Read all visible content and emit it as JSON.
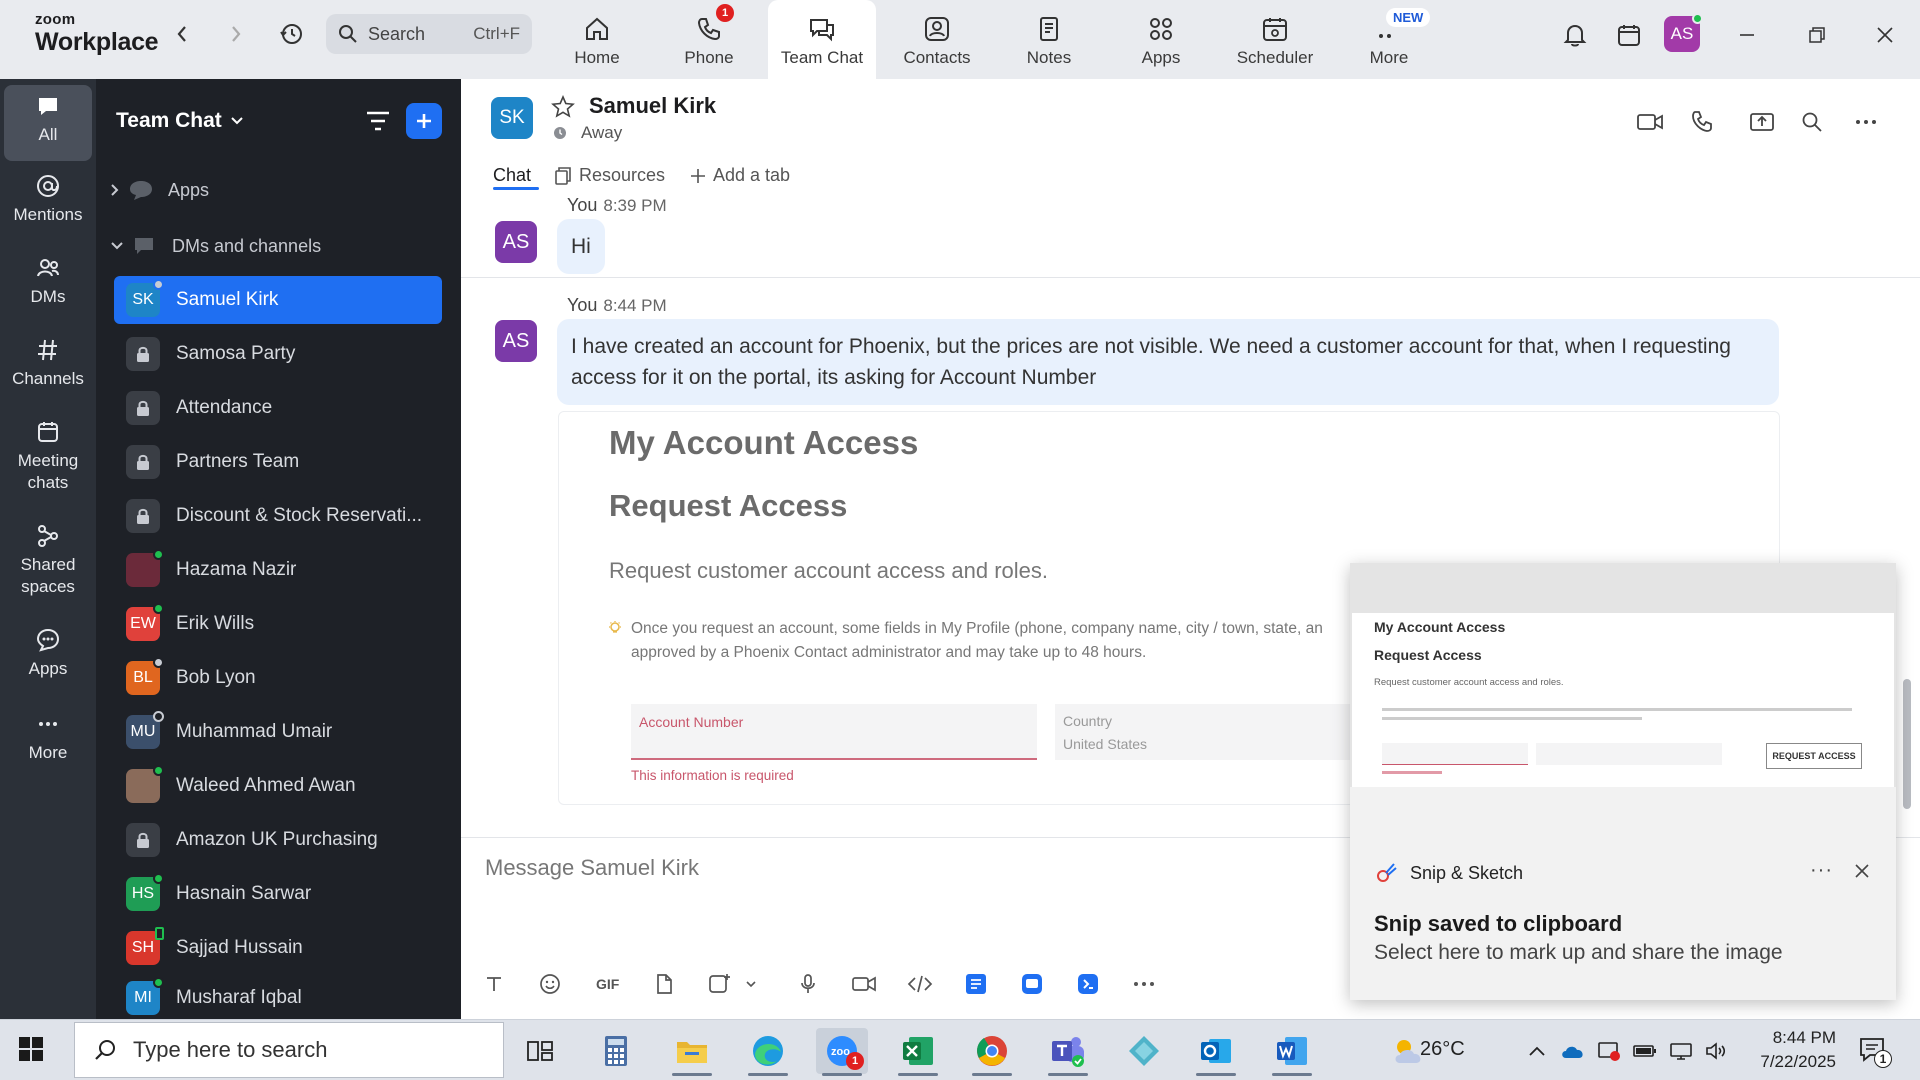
{
  "brand": {
    "line1": "zoom",
    "line2": "Workplace"
  },
  "search": {
    "placeholder": "Search",
    "shortcut": "Ctrl+F"
  },
  "nav": {
    "tabs": [
      {
        "label": "Home",
        "icon": "home-icon"
      },
      {
        "label": "Phone",
        "icon": "phone-icon",
        "badge": "1"
      },
      {
        "label": "Team Chat",
        "icon": "chat-icon",
        "active": true
      },
      {
        "label": "Contacts",
        "icon": "contacts-icon"
      },
      {
        "label": "Notes",
        "icon": "notes-icon"
      },
      {
        "label": "Apps",
        "icon": "apps-icon"
      },
      {
        "label": "Scheduler",
        "icon": "scheduler-icon"
      },
      {
        "label": "More",
        "icon": "more-icon",
        "new_badge": "NEW"
      }
    ],
    "user_initials": "AS"
  },
  "rail": {
    "items": [
      {
        "label": "All",
        "active": true
      },
      {
        "label": "Mentions"
      },
      {
        "label": "DMs"
      },
      {
        "label": "Channels"
      },
      {
        "label": "Meeting chats"
      },
      {
        "label": "Shared spaces"
      },
      {
        "label": "Apps"
      },
      {
        "label": "More"
      }
    ]
  },
  "sidebar": {
    "title": "Team Chat",
    "groups": {
      "apps": "Apps",
      "dms": "DMs and channels"
    },
    "items": [
      {
        "name": "Samuel Kirk",
        "initials": "SK",
        "color": "#1e85c7",
        "status": "away",
        "selected": true
      },
      {
        "name": "Samosa Party",
        "locked": true
      },
      {
        "name": "Attendance",
        "locked": true
      },
      {
        "name": "Partners Team",
        "locked": true
      },
      {
        "name": "Discount & Stock Reservati...",
        "locked": true
      },
      {
        "name": "Hazama Nazir",
        "initials": "",
        "color": "#6b2a3a",
        "status": "online"
      },
      {
        "name": "Erik Wills",
        "initials": "EW",
        "color": "#e0413b",
        "status": "online"
      },
      {
        "name": "Bob Lyon",
        "initials": "BL",
        "color": "#e0661f",
        "status": "away"
      },
      {
        "name": "Muhammad Umair",
        "initials": "MU",
        "color": "#3b4f6b",
        "status": "offline"
      },
      {
        "name": "Waleed Ahmed Awan",
        "initials": "",
        "color": "#8a6b5a",
        "status": "online"
      },
      {
        "name": "Amazon UK Purchasing",
        "locked": true
      },
      {
        "name": "Hasnain Sarwar",
        "initials": "HS",
        "color": "#1f9d55",
        "status": "online"
      },
      {
        "name": "Sajjad Hussain",
        "initials": "SH",
        "color": "#d9372c",
        "status": "mobile"
      },
      {
        "name": "Musharaf Iqbal",
        "initials": "MI",
        "color": "#1e85c7",
        "status": "online"
      }
    ]
  },
  "chat": {
    "contact_initials": "SK",
    "contact_name": "Samuel Kirk",
    "contact_status": "Away",
    "tabs": {
      "chat": "Chat",
      "resources": "Resources",
      "add": "Add a tab"
    },
    "messages": [
      {
        "author": "You",
        "time": "8:39 PM",
        "initials": "AS",
        "text": "Hi"
      },
      {
        "author": "You",
        "time": "8:44 PM",
        "initials": "AS",
        "text": "I have created an account for Phoenix, but the prices are not visible. We need a customer account for that, when I requesting access for it on the portal, its asking for Account Number"
      }
    ],
    "attachment": {
      "heading1": "My Account Access",
      "heading2": "Request Access",
      "subtitle": "Request customer account access and roles.",
      "note": "Once you request an account, some fields in My Profile (phone, company name, city / town, state, an approved by a Phoenix Contact administrator and may take up to 48 hours.",
      "account_label": "Account Number",
      "required_text": "This information is required",
      "country_label": "Country",
      "country_value": "United States"
    },
    "composer_placeholder": "Message Samuel Kirk"
  },
  "toast": {
    "app_name": "Snip & Sketch",
    "title": "Snip saved to clipboard",
    "body": "Select here to mark up and share the image",
    "preview": {
      "h1": "My Account Access",
      "h2": "Request Access",
      "sub": "Request customer account access and roles.",
      "button": "REQUEST ACCESS"
    }
  },
  "taskbar": {
    "search_placeholder": "Type here to search",
    "temperature": "26°C",
    "time": "8:44 PM",
    "date": "7/22/2025",
    "notification_count": "1",
    "zoom_badge": "1"
  },
  "colors": {
    "accent": "#1f6ff2",
    "sidebar_bg": "#1e2127",
    "rail_bg": "#2b3038",
    "bubble": "#e8f1fd"
  }
}
